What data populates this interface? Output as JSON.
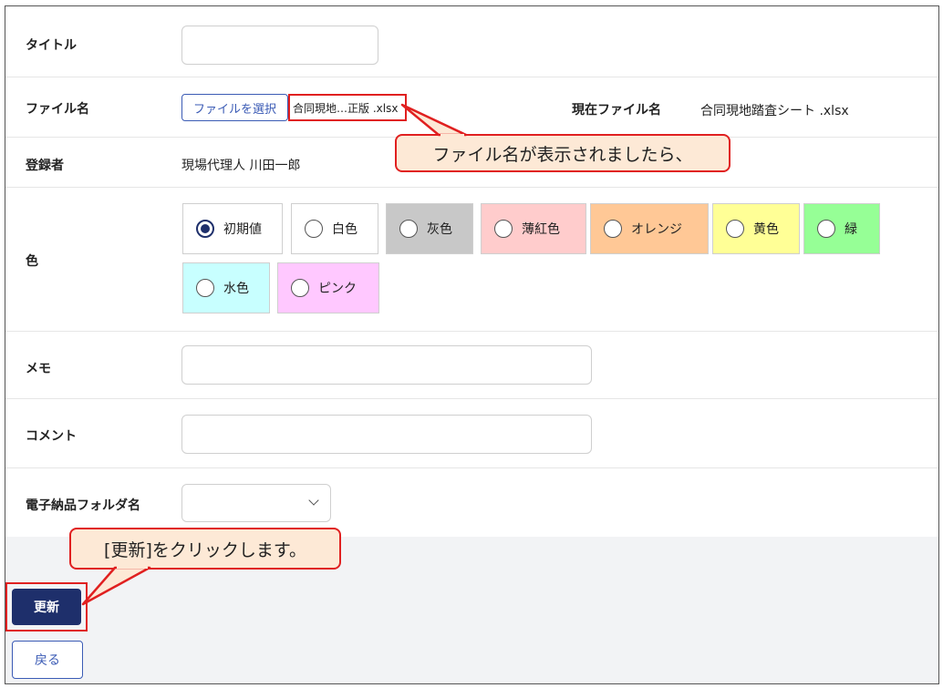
{
  "form": {
    "title": {
      "label": "タイトル",
      "value": ""
    },
    "file": {
      "label": "ファイル名",
      "button_label": "ファイルを選択",
      "selected_name": "合同現地…正版 .xlsx",
      "current_label": "現在ファイル名",
      "current_value": "合同現地踏査シート .xlsx"
    },
    "registrant": {
      "label": "登録者",
      "value": "現場代理人 川田一郎"
    },
    "color": {
      "label": "色",
      "options": [
        {
          "label": "初期値",
          "checked": true,
          "bg": "#ffffff"
        },
        {
          "label": "白色",
          "checked": false,
          "bg": "#ffffff"
        },
        {
          "label": "灰色",
          "checked": false,
          "bg": "#c8c8c8"
        },
        {
          "label": "薄紅色",
          "checked": false,
          "bg": "#ffcccc"
        },
        {
          "label": "オレンジ",
          "checked": false,
          "bg": "#ffc896"
        },
        {
          "label": "黄色",
          "checked": false,
          "bg": "#ffff96"
        },
        {
          "label": "緑",
          "checked": false,
          "bg": "#96ff96"
        },
        {
          "label": "水色",
          "checked": false,
          "bg": "#c8ffff"
        },
        {
          "label": "ピンク",
          "checked": false,
          "bg": "#ffc8ff"
        }
      ]
    },
    "memo": {
      "label": "メモ",
      "value": ""
    },
    "comment": {
      "label": "コメント",
      "value": ""
    },
    "folder": {
      "label": "電子納品フォルダ名",
      "value": ""
    }
  },
  "actions": {
    "update_label": "更新",
    "back_label": "戻る"
  },
  "callouts": {
    "file": "ファイル名が表示されましたら、",
    "update": "[更新]をクリックします。"
  },
  "colors": {
    "accent": "#1e2f6b",
    "link": "#3b5bb5",
    "highlight": "#e02020",
    "callout_bg": "#fde9d6"
  }
}
